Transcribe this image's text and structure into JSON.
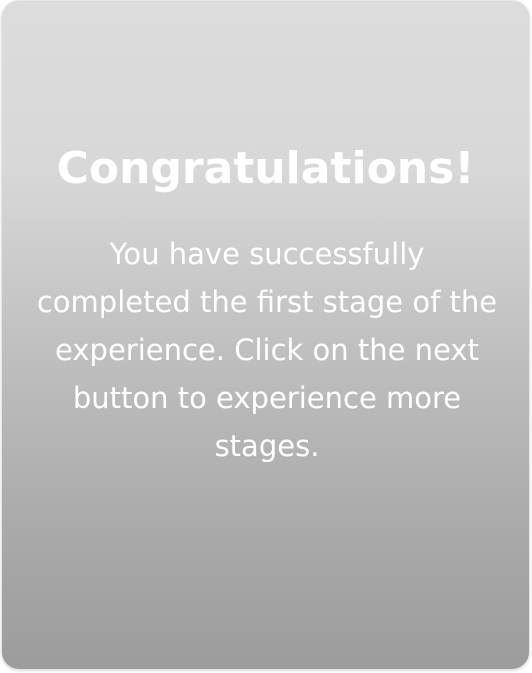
{
  "card": {
    "title": "Congratulations!",
    "message": "You have successfully completed the first stage of the experience. Click on the next button to experience more stages."
  },
  "colors": {
    "gradient_top": "#dcdcdc",
    "gradient_bottom": "#9c9c9c",
    "text": "#ffffff"
  }
}
